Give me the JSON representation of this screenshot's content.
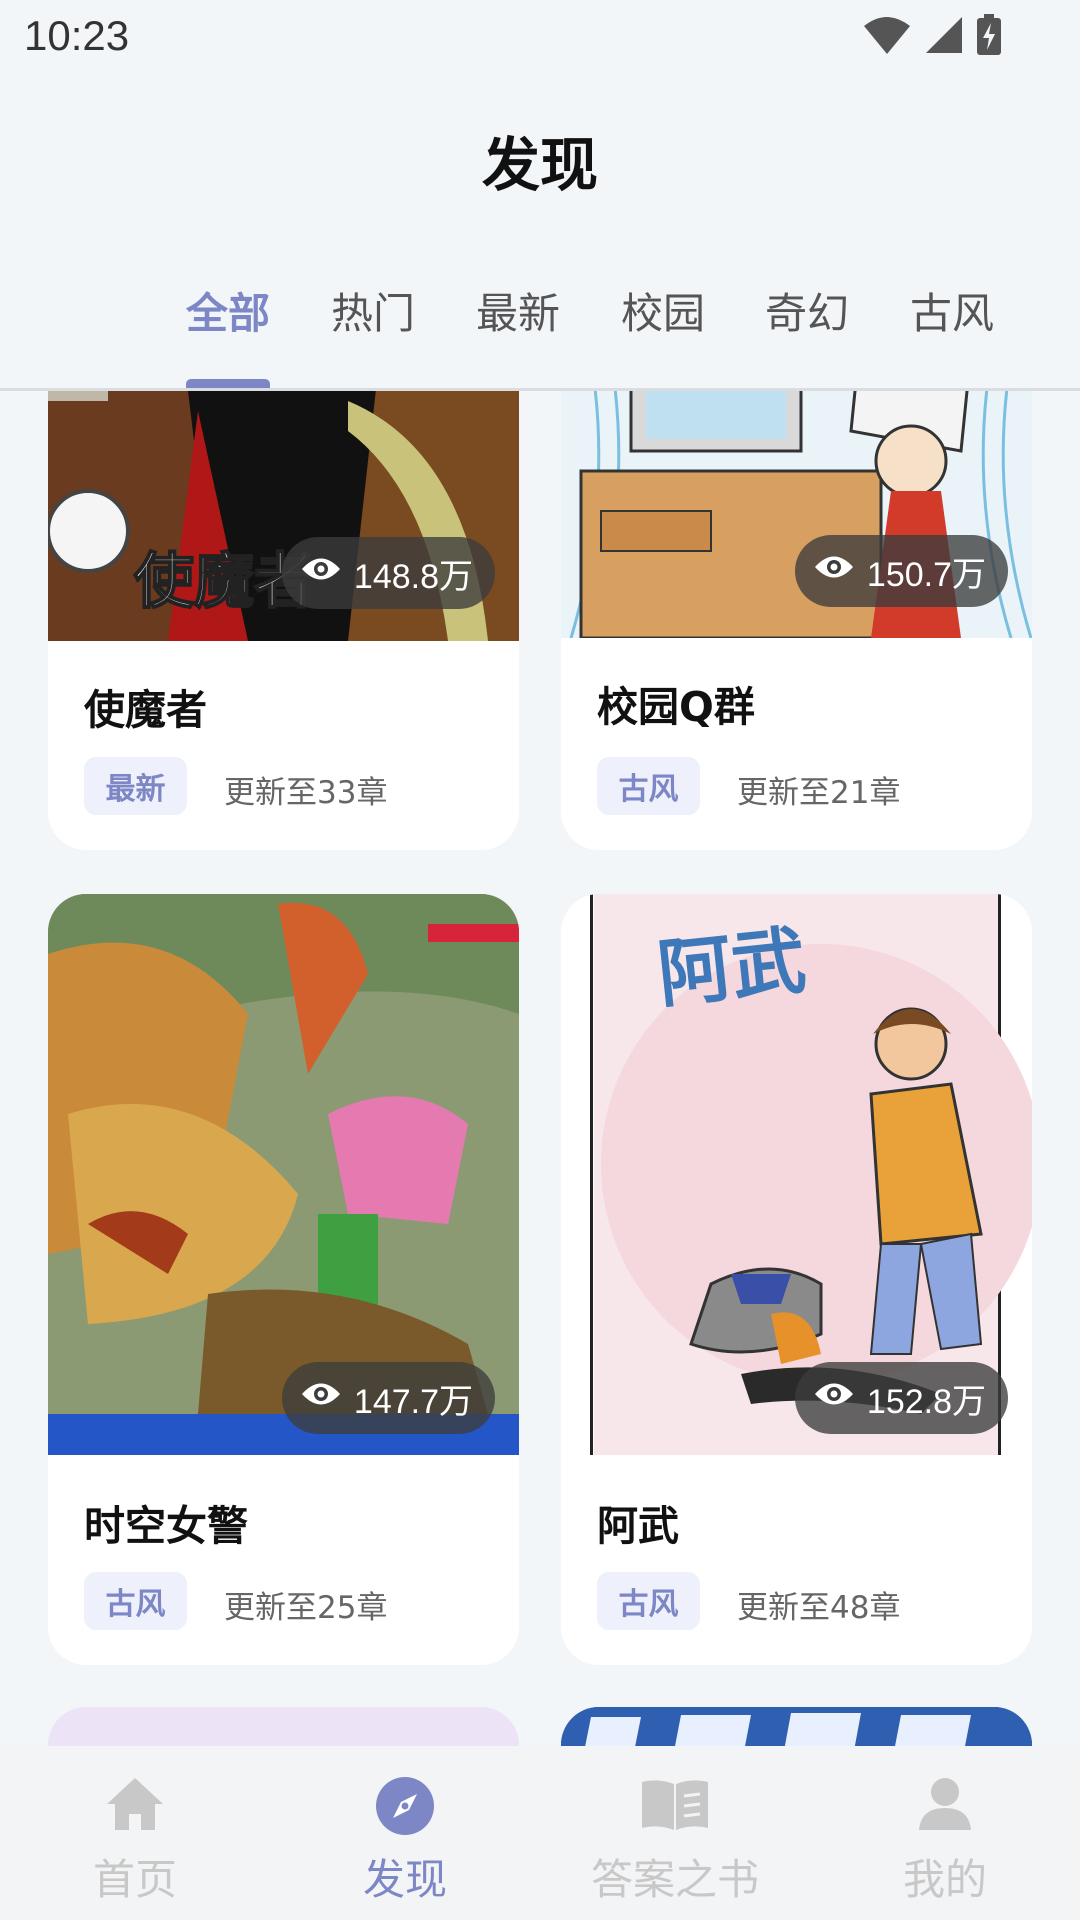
{
  "status_bar": {
    "time": "10:23"
  },
  "header": {
    "title": "发现"
  },
  "tabs": [
    {
      "label": "全部",
      "active": true
    },
    {
      "label": "热门",
      "active": false
    },
    {
      "label": "最新",
      "active": false
    },
    {
      "label": "校园",
      "active": false
    },
    {
      "label": "奇幻",
      "active": false
    },
    {
      "label": "古风",
      "active": false
    }
  ],
  "cards": [
    {
      "title": "使魔者",
      "views": "148.8万",
      "tag": "最新",
      "update": "更新至33章",
      "cover_text": "使魔者"
    },
    {
      "title": "校园Q群",
      "views": "150.7万",
      "tag": "古风",
      "update": "更新至21章"
    },
    {
      "title": "时空女警",
      "views": "147.7万",
      "tag": "古风",
      "update": "更新至25章"
    },
    {
      "title": "阿武",
      "views": "152.8万",
      "tag": "古风",
      "update": "更新至48章",
      "cover_text": "阿武"
    }
  ],
  "bottom_nav": [
    {
      "label": "首页",
      "icon": "home-icon",
      "active": false
    },
    {
      "label": "发现",
      "icon": "compass-icon",
      "active": true
    },
    {
      "label": "答案之书",
      "icon": "book-icon",
      "active": false
    },
    {
      "label": "我的",
      "icon": "person-icon",
      "active": false
    }
  ],
  "colors": {
    "accent": "#7d87c6",
    "background": "#f2f6f8",
    "tag_bg": "#eef0fb",
    "nav_inactive": "#c8c8c8"
  }
}
